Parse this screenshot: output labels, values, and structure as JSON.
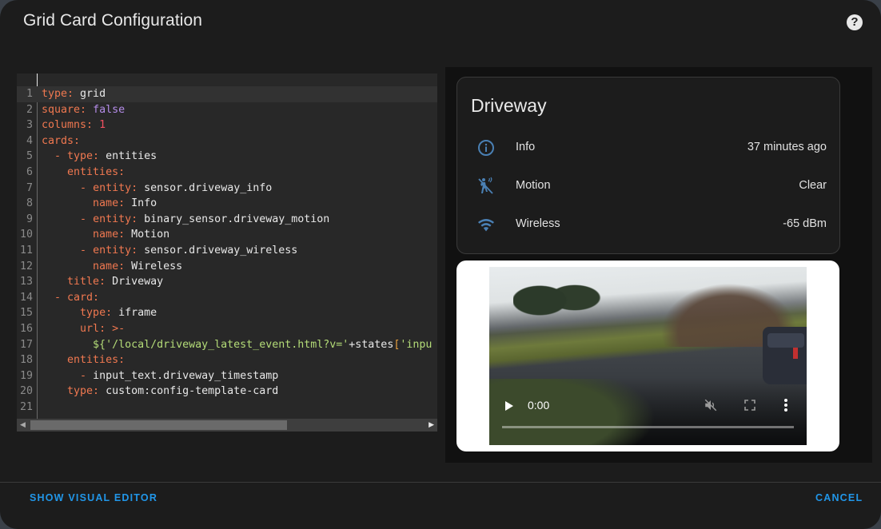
{
  "dialog": {
    "title": "Grid Card Configuration",
    "help_icon": "help-circle-icon"
  },
  "editor": {
    "lines": [
      {
        "n": "1",
        "indent": "",
        "dash": "",
        "key": "type",
        "value": "grid",
        "vtype": "v"
      },
      {
        "n": "2",
        "indent": "",
        "dash": "",
        "key": "square",
        "value": "false",
        "vtype": "b"
      },
      {
        "n": "3",
        "indent": "",
        "dash": "",
        "key": "columns",
        "value": "1",
        "vtype": "n"
      },
      {
        "n": "4",
        "indent": "",
        "dash": "",
        "key": "cards",
        "value": "",
        "vtype": "v"
      },
      {
        "n": "5",
        "indent": "  ",
        "dash": "- ",
        "key": "type",
        "value": "entities",
        "vtype": "v"
      },
      {
        "n": "6",
        "indent": "    ",
        "dash": "",
        "key": "entities",
        "value": "",
        "vtype": "v"
      },
      {
        "n": "7",
        "indent": "      ",
        "dash": "- ",
        "key": "entity",
        "value": "sensor.driveway_info",
        "vtype": "v"
      },
      {
        "n": "8",
        "indent": "        ",
        "dash": "",
        "key": "name",
        "value": "Info",
        "vtype": "v"
      },
      {
        "n": "9",
        "indent": "      ",
        "dash": "- ",
        "key": "entity",
        "value": "binary_sensor.driveway_motion",
        "vtype": "v"
      },
      {
        "n": "10",
        "indent": "        ",
        "dash": "",
        "key": "name",
        "value": "Motion",
        "vtype": "v"
      },
      {
        "n": "11",
        "indent": "      ",
        "dash": "- ",
        "key": "entity",
        "value": "sensor.driveway_wireless",
        "vtype": "v"
      },
      {
        "n": "12",
        "indent": "        ",
        "dash": "",
        "key": "name",
        "value": "Wireless",
        "vtype": "v"
      },
      {
        "n": "13",
        "indent": "    ",
        "dash": "",
        "key": "title",
        "value": "Driveway",
        "vtype": "v"
      },
      {
        "n": "14",
        "indent": "  ",
        "dash": "- ",
        "key": "card",
        "value": "",
        "vtype": "v"
      },
      {
        "n": "15",
        "indent": "      ",
        "dash": "",
        "key": "type",
        "value": "iframe",
        "vtype": "v"
      },
      {
        "n": "16",
        "indent": "      ",
        "dash": "",
        "key": "url",
        "value": ">-",
        "vtype": "k"
      },
      {
        "n": "17",
        "indent": "        ",
        "dash": "",
        "key": "",
        "value": "${'/local/driveway_latest_event.html?v='+states['inpu",
        "vtype": "template"
      },
      {
        "n": "18",
        "indent": "    ",
        "dash": "",
        "key": "entities",
        "value": "",
        "vtype": "v"
      },
      {
        "n": "19",
        "indent": "      ",
        "dash": "- ",
        "key": "",
        "value": "input_text.driveway_timestamp",
        "vtype": "v"
      },
      {
        "n": "20",
        "indent": "    ",
        "dash": "",
        "key": "type",
        "value": "custom:config-template-card",
        "vtype": "v"
      },
      {
        "n": "21",
        "indent": "",
        "dash": "",
        "key": "",
        "value": "",
        "vtype": "v"
      }
    ],
    "active_line": 1,
    "scroll_left_icon": "chevron-left-icon",
    "scroll_right_icon": "chevron-right-icon"
  },
  "preview": {
    "entities_card": {
      "title": "Driveway",
      "rows": [
        {
          "icon": "information-outline-icon",
          "name": "Info",
          "state": "37 minutes ago"
        },
        {
          "icon": "motion-sensor-off-icon",
          "name": "Motion",
          "state": "Clear"
        },
        {
          "icon": "wifi-icon",
          "name": "Wireless",
          "state": "-65 dBm"
        }
      ]
    },
    "video": {
      "time": "0:00",
      "progress": 0,
      "play_icon": "play-icon",
      "mute_icon": "volume-off-icon",
      "fullscreen_icon": "fullscreen-icon",
      "more_icon": "more-vertical-icon"
    }
  },
  "footer": {
    "show_visual_editor": "Show Visual Editor",
    "cancel": "Cancel"
  },
  "colors": {
    "accent": "#2196e8",
    "icon": "#4a80b4",
    "yaml_key": "#f07850",
    "yaml_bool": "#b48ce8",
    "yaml_number": "#f05060",
    "yaml_string": "#b4dc78"
  }
}
